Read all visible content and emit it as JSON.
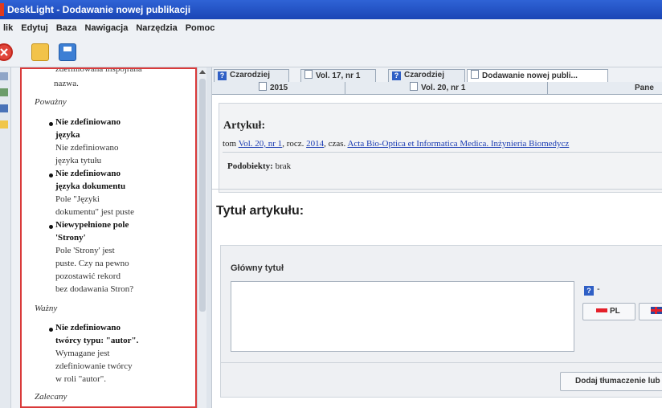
{
  "window": {
    "title": "DeskLight - Dodawanie nowej publikacji"
  },
  "menu": [
    "lik",
    "Edytuj",
    "Baza",
    "Nawigacja",
    "Narzędzia",
    "Pomoc"
  ],
  "toolbar": {
    "icons": [
      "close-icon",
      "open-icon",
      "save-icon"
    ]
  },
  "messages": {
    "clipped_text": "zdefiniowana inspojrana",
    "prev_tail": "nazwa.",
    "groups": [
      {
        "category": "Poważny"
      },
      {
        "category": "Ważny"
      },
      {
        "category": "Zalecany"
      }
    ],
    "items": [
      {
        "title_1": "Nie zdefiniowano",
        "title_2": "języka",
        "desc_1": "Nie zdefiniowano",
        "desc_2": "języka tytułu"
      },
      {
        "title_1": "Nie zdefiniowano",
        "title_2": "języka dokumentu",
        "desc_1": "Pole \"Języki",
        "desc_2": "dokumentu\" jest puste"
      },
      {
        "title_1": "Niewypełnione pole",
        "title_2": "'Strony'",
        "desc_1": "Pole 'Strony' jest",
        "desc_2": "puste. Czy na pewno",
        "desc_3": "pozostawić rekord",
        "desc_4": "bez dodawania Stron?"
      },
      {
        "title_1": "Nie zdefiniowano",
        "title_2": "twórcy typu: \"autor\".",
        "desc_1": "Wymagane jest",
        "desc_2": "zdefiniowanie twórcy",
        "desc_3": "w roli \"autor\"."
      }
    ]
  },
  "tabs_top": [
    {
      "label": "Czarodziej",
      "icon": "question-icon"
    },
    {
      "label": "Vol. 17, nr 1",
      "icon": "document-icon"
    },
    {
      "label": "Czarodziej",
      "icon": "question-icon"
    },
    {
      "label": "Dodawanie nowej publi...",
      "icon": "edit-icon"
    }
  ],
  "tabs_second": [
    {
      "label": "2015",
      "icon": "document-icon"
    },
    {
      "label": "Vol. 20, nr 1",
      "icon": "document-icon"
    },
    {
      "label": "Pane",
      "icon": ""
    }
  ],
  "article": {
    "heading": "Artykuł:",
    "meta_prefix": "tom",
    "volume_link": "Vol. 20, nr 1",
    "year_prefix": ", rocz.",
    "year_link": "2014",
    "journal_prefix": ", czas.",
    "journal_link": "Acta Bio-Optica et Informatica Medica. Inżynieria Biomedycz",
    "subobjects_label": "Podobiekty:",
    "subobjects_value": "brak"
  },
  "title_section": {
    "heading": "Tytuł artykułu:",
    "field_label": "Główny tytuł",
    "lang_indicator": "?",
    "lang_dash": "-",
    "lang_pl": "PL",
    "add_button": "Dodaj tłumaczenie lub"
  }
}
